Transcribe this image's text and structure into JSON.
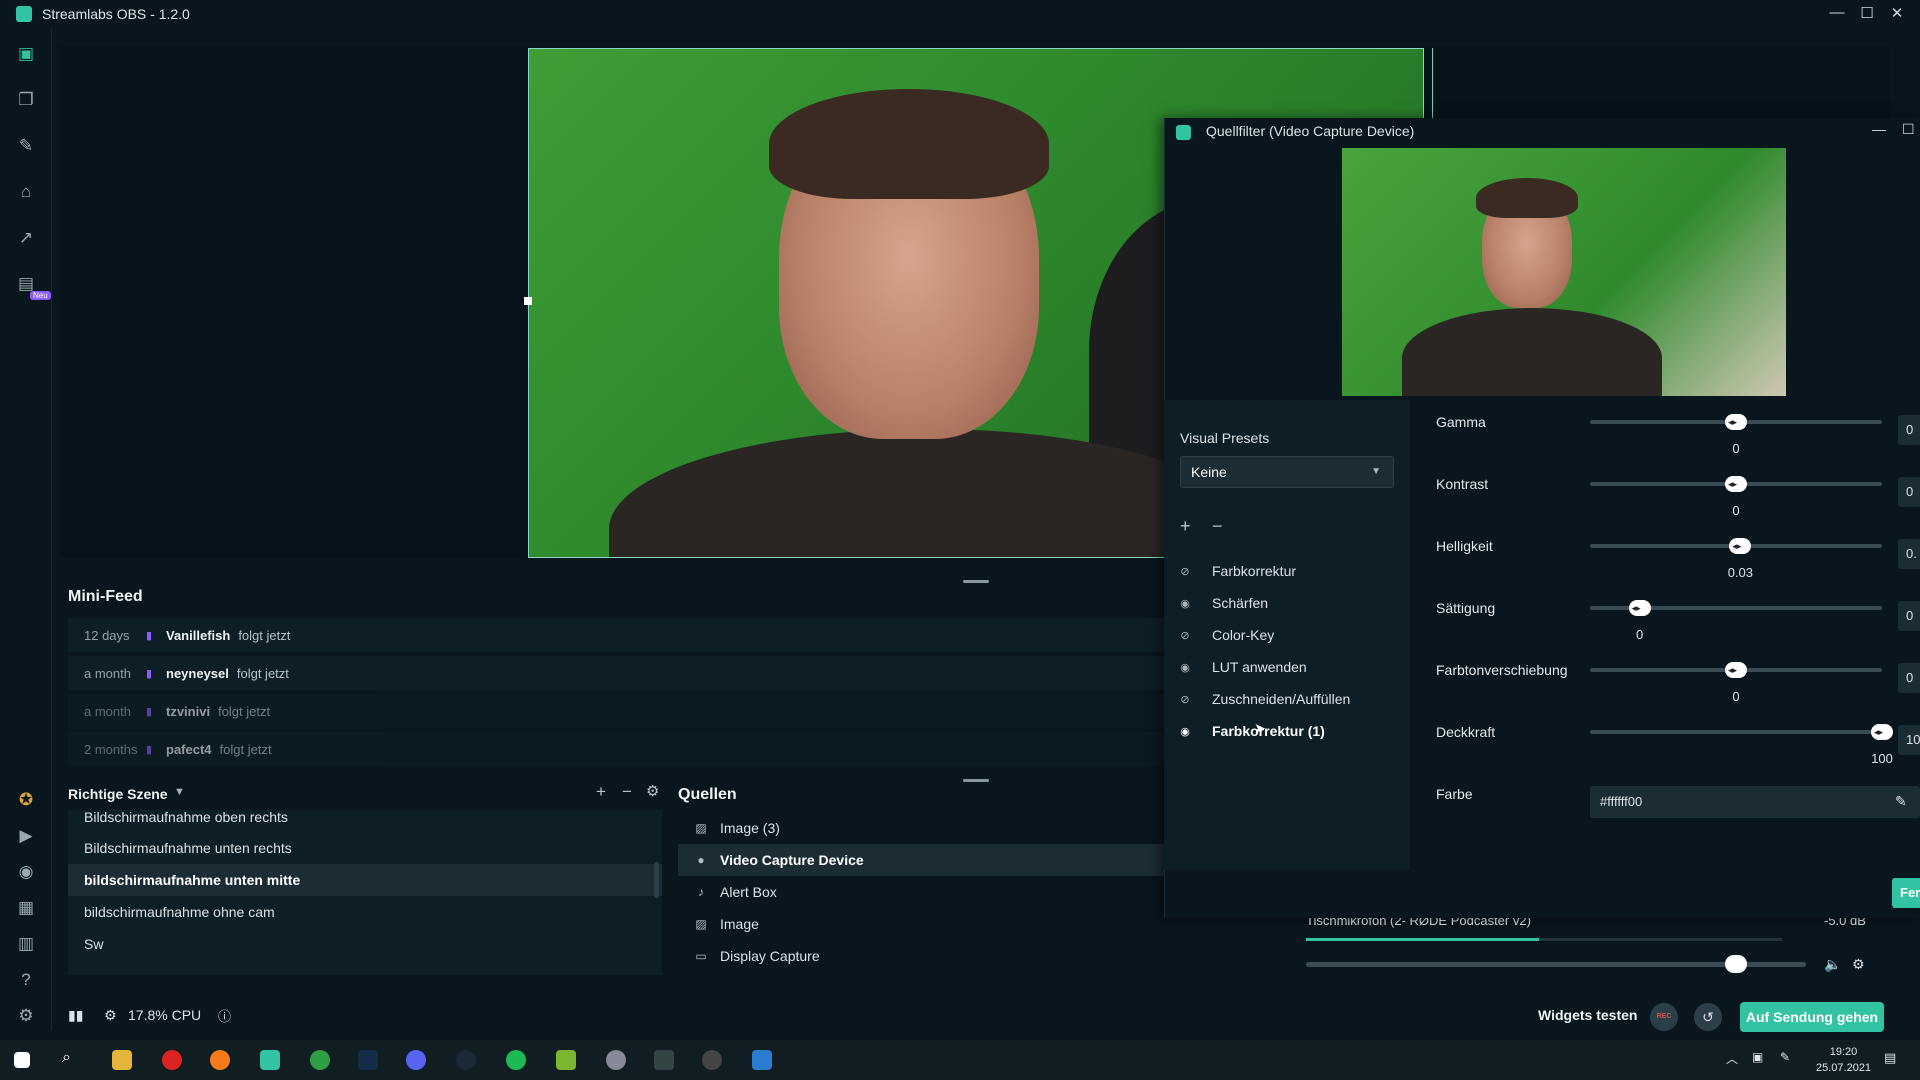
{
  "window": {
    "title": "Streamlabs OBS - 1.2.0",
    "controls": [
      "—",
      "☐",
      "✕"
    ]
  },
  "sidebar": {
    "badge": "Neu"
  },
  "mini_feed": {
    "title": "Mini-Feed",
    "items": [
      {
        "time": "12 days",
        "name": "Vanillefish",
        "action": "folgt jetzt"
      },
      {
        "time": "a month",
        "name": "neyneysel",
        "action": "folgt jetzt"
      },
      {
        "time": "a month",
        "name": "tzvinivi",
        "action": "folgt jetzt"
      },
      {
        "time": "2 months",
        "name": "pafect4",
        "action": "folgt jetzt"
      }
    ]
  },
  "scenes": {
    "title": "Richtige Szene",
    "items": [
      "Bildschirmaufnahme oben rechts",
      "Bildschirmaufnahme unten rechts",
      "bildschirmaufnahme unten mitte",
      "bildschirmaufnahme ohne cam",
      "Sw"
    ],
    "selected_index": 2
  },
  "sources": {
    "title": "Quellen",
    "items": [
      {
        "label": "Image (3)",
        "icon": "image-icon"
      },
      {
        "label": "Video Capture Device",
        "icon": "camera-icon"
      },
      {
        "label": "Alert Box",
        "icon": "bell-icon"
      },
      {
        "label": "Image",
        "icon": "image-icon"
      },
      {
        "label": "Display Capture",
        "icon": "monitor-icon"
      }
    ],
    "selected_index": 1
  },
  "mixer": {
    "name": "Tischmikrofon (2- RØDE Podcaster v2)",
    "db": "-5.0 dB",
    "level": 0.49,
    "volume": 0.86
  },
  "footer": {
    "cpu": "17.8% CPU",
    "widgets": "Widgets testen",
    "rec": "REC",
    "golive": "Auf Sendung gehen"
  },
  "clock": {
    "time": "19:20",
    "date": "25.07.2021"
  },
  "dialog": {
    "title": "Quellfilter (Video Capture Device)",
    "visual_presets_label": "Visual Presets",
    "visual_presets_value": "Keine",
    "filters": [
      {
        "label": "Farbkorrektur",
        "icon": "eye-off-icon"
      },
      {
        "label": "Schärfen",
        "icon": "eye-icon"
      },
      {
        "label": "Color-Key",
        "icon": "eye-off-icon"
      },
      {
        "label": "LUT anwenden",
        "icon": "eye-icon"
      },
      {
        "label": "Zuschneiden/Auffüllen",
        "icon": "eye-off-icon"
      },
      {
        "label": "Farbkorrektur (1)",
        "icon": "eye-icon"
      }
    ],
    "selected_filter": 5,
    "params": [
      {
        "label": "Gamma",
        "value": "0",
        "box": "0",
        "fraction": 0.5
      },
      {
        "label": "Kontrast",
        "value": "0",
        "box": "0",
        "fraction": 0.5
      },
      {
        "label": "Helligkeit",
        "value": "0.03",
        "box": "0.",
        "fraction": 0.515
      },
      {
        "label": "Sättigung",
        "value": "0",
        "box": "0",
        "fraction": 0.17
      },
      {
        "label": "Farbtonverschiebung",
        "value": "0",
        "box": "0",
        "fraction": 0.5
      },
      {
        "label": "Deckkraft",
        "value": "100",
        "box": "10",
        "fraction": 1.0
      }
    ],
    "color_label": "Farbe",
    "color_value": "#ffffff00",
    "done_label": "Fer"
  },
  "colors": {
    "accent": "#31c3a2",
    "bg": "#09161d",
    "panel": "#0e1e26"
  }
}
